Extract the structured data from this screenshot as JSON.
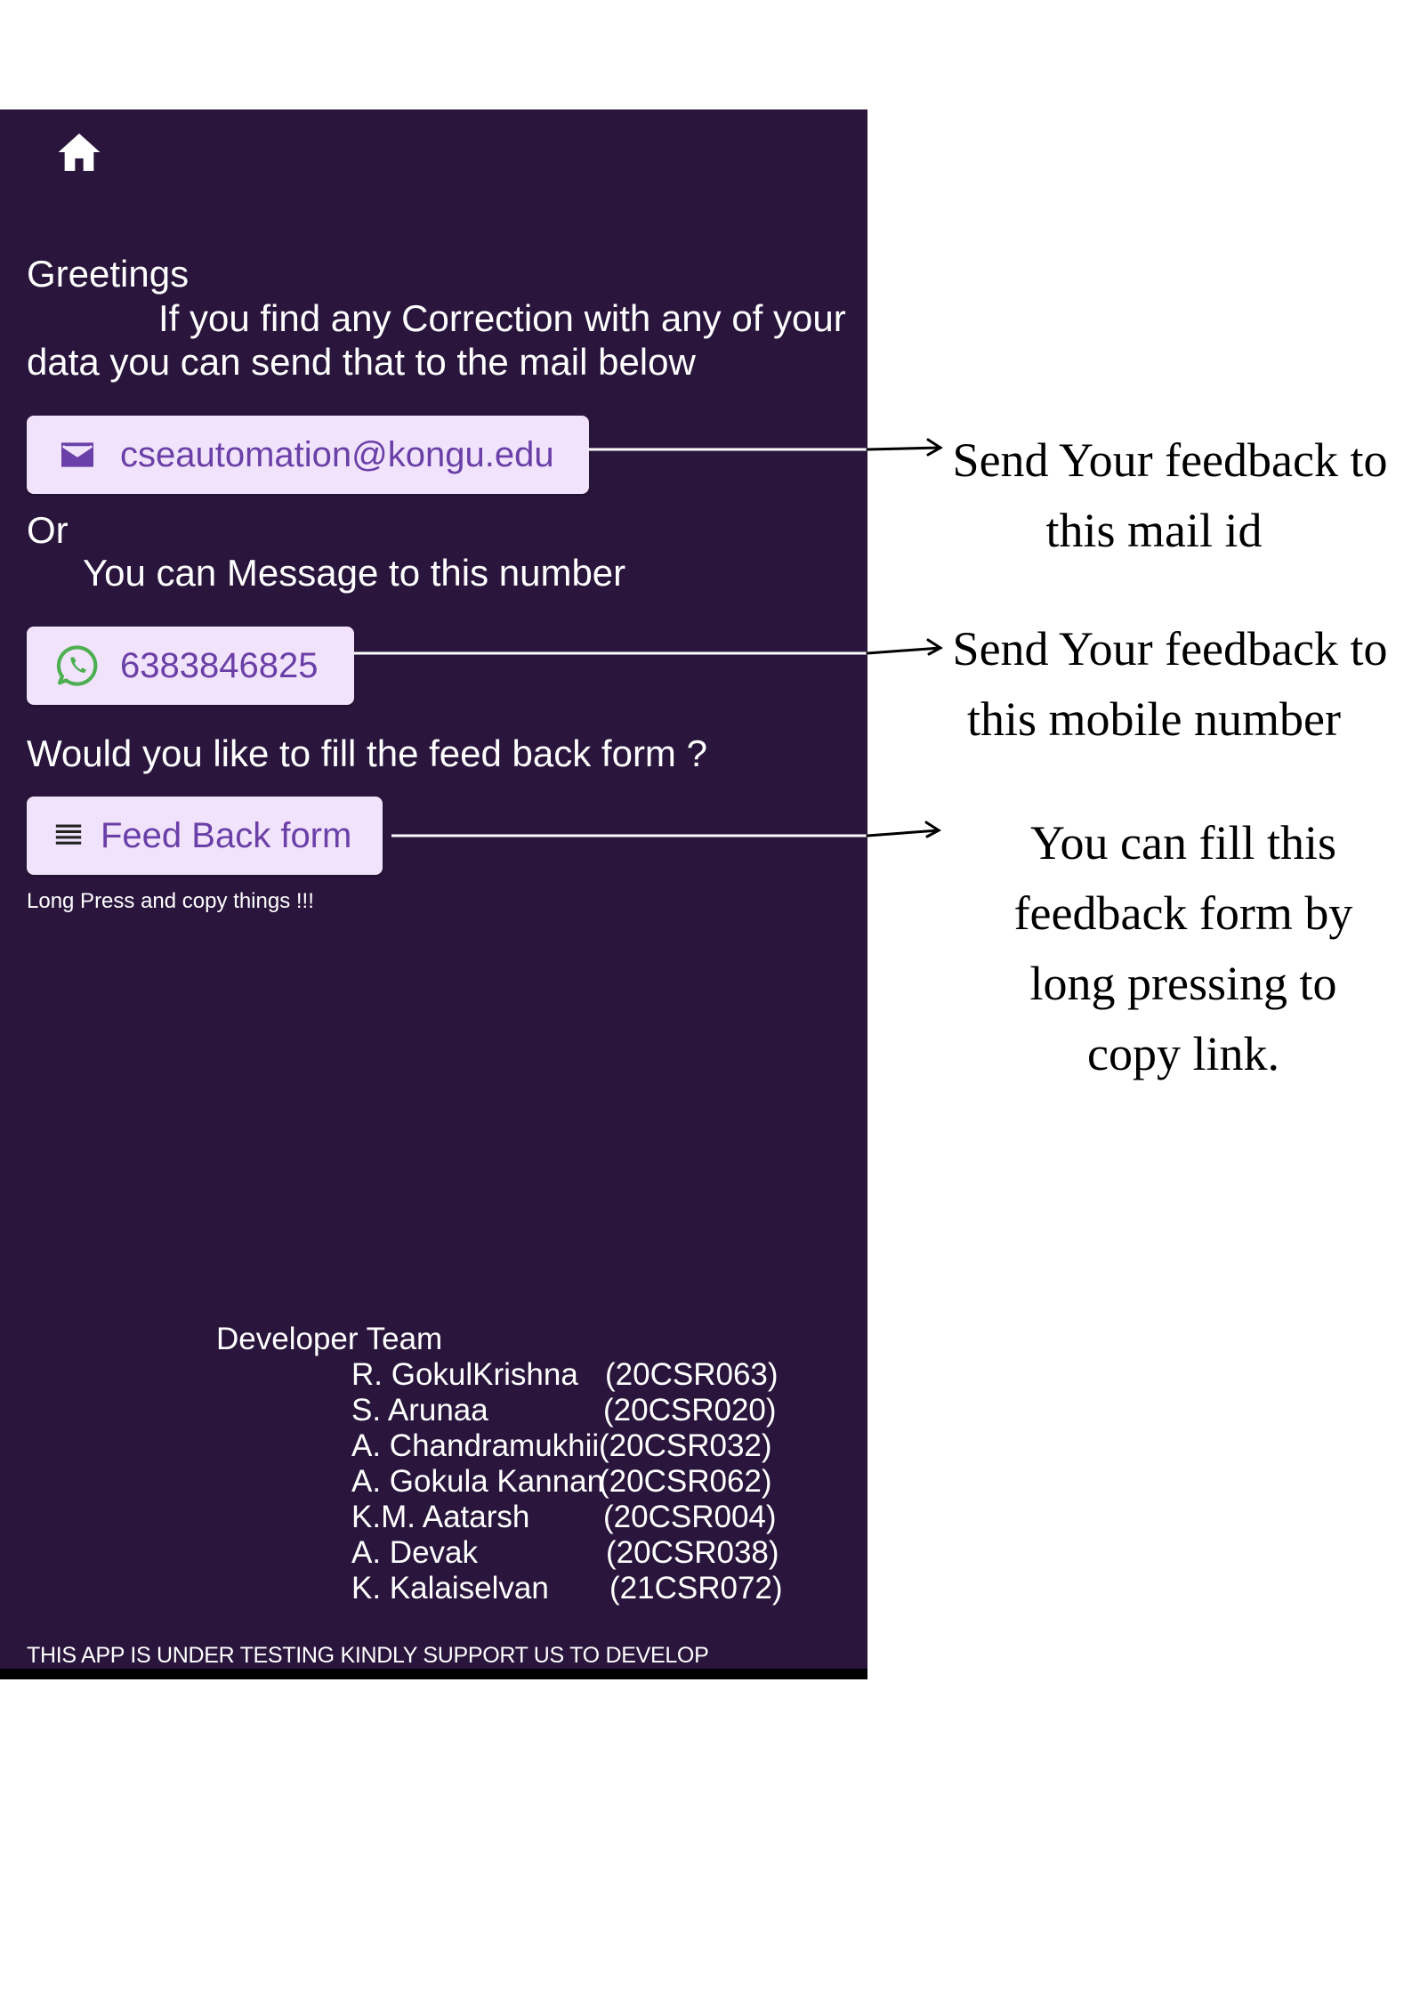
{
  "app": {
    "greeting": "Greetings",
    "message_line1": "If you find any Correction with any of your",
    "message_line2": "data you can send that to the mail below",
    "email_button": {
      "icon": "mail-icon",
      "label": "cseautomation@kongu.edu"
    },
    "or_text": "Or",
    "message_number_text": "You can Message to this number",
    "phone_button": {
      "icon": "whatsapp-icon",
      "label": "6383846825"
    },
    "form_question": "Would you like to fill the feed back form ?",
    "form_button": {
      "icon": "list-icon",
      "label": "Feed Back form"
    },
    "long_press_hint": "Long Press and copy things !!!",
    "developer_team": {
      "title": "Developer Team",
      "members": [
        {
          "name": "R. GokulKrishna",
          "id": "(20CSR063)"
        },
        {
          "name": "S. Arunaa",
          "id": "(20CSR020)"
        },
        {
          "name": "A. Chandramukhii",
          "id": "(20CSR032)"
        },
        {
          "name": "A. Gokula Kannan",
          "id": "(20CSR062)"
        },
        {
          "name": "K.M. Aatarsh",
          "id": "(20CSR004)"
        },
        {
          "name": "A. Devak",
          "id": "(20CSR038)"
        },
        {
          "name": "K. Kalaiselvan",
          "id": "(21CSR072)"
        }
      ]
    },
    "footer": "THIS APP IS UNDER TESTING KINDLY SUPPORT US TO DEVELOP"
  },
  "annotations": {
    "mail": [
      "Send  Your feedback to",
      "this mail id"
    ],
    "mobile": [
      "Send  Your feedback to",
      "this mobile number"
    ],
    "form": [
      "You can fill this",
      "feedback form by",
      "long pressing to",
      "copy link."
    ]
  },
  "colors": {
    "background": "#2a163d",
    "button_bg": "#f0e3fb",
    "button_text": "#6a3fa7",
    "whatsapp": "#4caf50"
  }
}
